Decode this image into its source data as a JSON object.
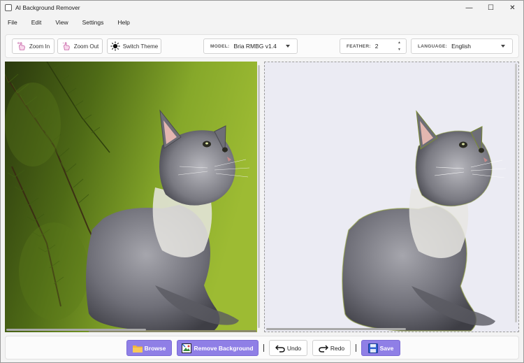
{
  "window": {
    "title": "AI Background Remover",
    "controls": {
      "minimize": "—",
      "maximize": "☐",
      "close": "✕"
    }
  },
  "menu": {
    "items": [
      "File",
      "Edit",
      "View",
      "Settings",
      "Help"
    ]
  },
  "toolbar": {
    "zoom_in": "Zoom In",
    "zoom_out": "Zoom Out",
    "switch_theme": "Switch Theme",
    "model_label": "MODEL:",
    "model_value": "Bria RMBG v1.4",
    "feather_label": "FEATHER:",
    "feather_value": "2",
    "language_label": "LANGUAGE:",
    "language_value": "English"
  },
  "actions": {
    "browse": "Browse",
    "remove_background": "Remove Background",
    "undo": "Undo",
    "redo": "Redo",
    "save": "Save"
  },
  "colors": {
    "accent": "#8f7fe6",
    "result_background": "#ebebf3",
    "foliage_dark": "#2d3b10",
    "foliage_light": "#8fb12c",
    "cat_fur": "#7c7c84"
  },
  "icons": {
    "zoom_in": "hand-pinch-icon",
    "zoom_out": "hand-pinch-icon",
    "switch_theme": "sun-moon-icon",
    "browse": "folder-icon",
    "remove_background": "image-edit-icon",
    "undo": "undo-arrow-icon",
    "redo": "redo-arrow-icon",
    "save": "floppy-disk-icon"
  }
}
